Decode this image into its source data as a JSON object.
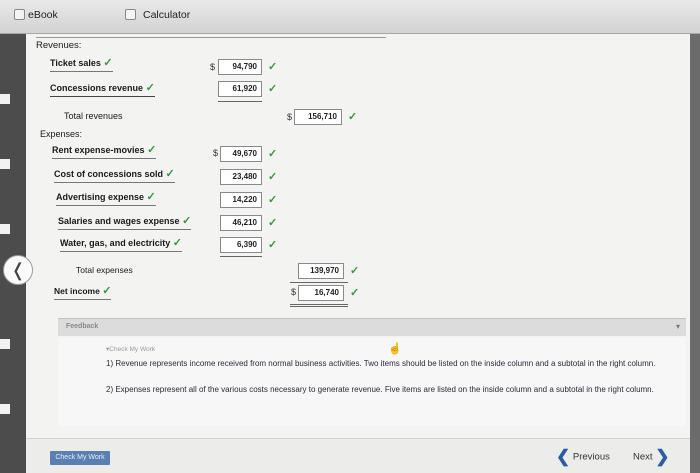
{
  "tabs": {
    "ebook": "eBook",
    "calculator": "Calculator"
  },
  "statement": {
    "revenues_heading": "Revenues:",
    "revenues": [
      {
        "label": "Ticket sales",
        "amount": "94,790"
      },
      {
        "label": "Concessions revenue",
        "amount": "61,920"
      }
    ],
    "total_revenues_label": "Total revenues",
    "total_revenues": "156,710",
    "expenses_heading": "Expenses:",
    "expenses": [
      {
        "label": "Rent expense-movies",
        "amount": "49,670"
      },
      {
        "label": "Cost of concessions sold",
        "amount": "23,480"
      },
      {
        "label": "Advertising expense",
        "amount": "14,220"
      },
      {
        "label": "Salaries and wages expense",
        "amount": "46,210"
      },
      {
        "label": "Water, gas, and electricity",
        "amount": "6,390"
      }
    ],
    "total_expenses_label": "Total expenses",
    "total_expenses": "139,970",
    "net_income_label": "Net income",
    "net_income": "16,740",
    "currency": "$",
    "check_mark": "✓"
  },
  "feedback": {
    "title": "Feedback",
    "check_my_work": "Check My Work",
    "line1": "1) Revenue represents income received from normal business activities. Two items should be listed on the inside column and a subtotal in the right column.",
    "line2": "2) Expenses represent all of the various costs necessary to generate revenue. Five items are listed on the inside column and a subtotal in the right column."
  },
  "footer": {
    "check_my_work_button": "Check My Work",
    "previous": "Previous",
    "next": "Next"
  },
  "colors": {
    "check": "#2f9a3c",
    "nav_arrow": "#2b5aa6",
    "button": "#5a7fb3"
  }
}
